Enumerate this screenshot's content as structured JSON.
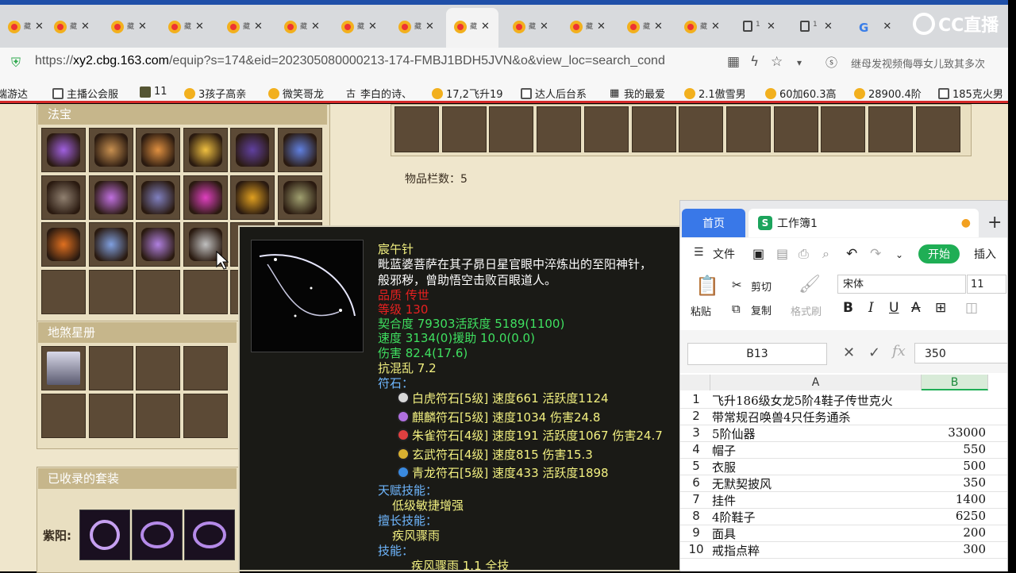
{
  "browser": {
    "tabs": [
      {
        "label": "藏",
        "type": "cbg"
      },
      {
        "label": "藏",
        "type": "cbg"
      },
      {
        "label": "藏",
        "type": "cbg"
      },
      {
        "label": "藏",
        "type": "cbg"
      },
      {
        "label": "藏",
        "type": "cbg"
      },
      {
        "label": "藏",
        "type": "cbg"
      },
      {
        "label": "藏",
        "type": "cbg"
      },
      {
        "label": "藏",
        "type": "cbg"
      },
      {
        "label": "藏",
        "type": "cbg",
        "active": true
      },
      {
        "label": "藏",
        "type": "cbg"
      },
      {
        "label": "藏",
        "type": "cbg"
      },
      {
        "label": "藏",
        "type": "cbg"
      },
      {
        "label": "藏",
        "type": "cbg"
      },
      {
        "label": "1",
        "type": "doc"
      },
      {
        "label": "1",
        "type": "doc"
      },
      {
        "label": "",
        "type": "g"
      }
    ],
    "close_glyph": "✕",
    "watermark": "CC直播",
    "url_prefix": "https://",
    "url_host": "xy2.cbg.163.com",
    "url_path": "/equip?s=174&eid=202305080000213-174-FMBJ1BDH5JVN&o&view_loc=search_cond",
    "search_hint": "继母发视频侮辱女儿致其多次",
    "bookmarks": [
      "端游达",
      "主播公会服",
      "11",
      "3孩子高亲",
      "微笑哥龙",
      "李白的诗、",
      "17,2飞升19",
      "达人后台系",
      "我的最爱",
      "2.1傲雪男",
      "60加60.3高",
      "28900.4阶",
      "185克火男"
    ]
  },
  "page": {
    "fabao_title": "法宝",
    "dishaxing_title": "地煞星册",
    "suit_title": "已收录的套装",
    "suit_label": "紫阳:",
    "item_count": "物品栏数：5"
  },
  "tooltip": {
    "name": "宸午针",
    "desc1": "毗蓝婆菩萨在其子昴日星官眼中淬炼出的至阳神针，",
    "desc2": "般邪秽，曾助悟空击败百眼道人。",
    "quality": "品质  传世",
    "level": "等级  130",
    "fit": "契合度     79303活跃度  5189(1100)",
    "speed": "速度     3134(0)援助     10.0(0.0)",
    "damage": "伤害     82.4(17.6)",
    "anti": "抗混乱 7.2",
    "rune_title": "符石：",
    "runes": [
      {
        "text": "白虎符石[5级] 速度661 活跃度1124",
        "color": "#d8d8d8"
      },
      {
        "text": "麒麟符石[5级] 速度1034 伤害24.8",
        "color": "#b070e0"
      },
      {
        "text": "朱雀符石[4级] 速度191 活跃度1067 伤害24.7",
        "color": "#e04040"
      },
      {
        "text": "玄武符石[4级] 速度815 伤害15.3",
        "color": "#d8b030"
      },
      {
        "text": "青龙符石[5级] 速度433 活跃度1898",
        "color": "#3a8ae0"
      }
    ],
    "talent_title": "天赋技能：",
    "talent": "低级敏捷增强",
    "special_title": "擅长技能：",
    "special": "疾风骤雨",
    "skill_title": "技能：",
    "skill_partial": "疾风骤雨 1.1 全技"
  },
  "sheet": {
    "home_tab": "首页",
    "book_tab": "工作簿1",
    "file_menu": "文件",
    "start_btn": "开始",
    "insert_menu": "插入",
    "paste": "粘贴",
    "cut": "剪切",
    "copy": "复制",
    "format_brush": "格式刷",
    "font": "宋体",
    "font_size": "11",
    "name_box": "B13",
    "formula": "350",
    "col_a": "A",
    "col_b": "B",
    "rows": [
      {
        "n": "1",
        "a": "飞升186级女龙5阶4鞋子传世克火",
        "b": ""
      },
      {
        "n": "2",
        "a": "带常规召唤兽4只任务通杀",
        "b": ""
      },
      {
        "n": "3",
        "a": "5阶仙器",
        "b": "33000"
      },
      {
        "n": "4",
        "a": "帽子",
        "b": "550"
      },
      {
        "n": "5",
        "a": "衣服",
        "b": "500"
      },
      {
        "n": "6",
        "a": "无默契披风",
        "b": "350"
      },
      {
        "n": "7",
        "a": "挂件",
        "b": "1400"
      },
      {
        "n": "8",
        "a": "4阶鞋子",
        "b": "6250"
      },
      {
        "n": "9",
        "a": "面具",
        "b": "200"
      },
      {
        "n": "10",
        "a": "戒指点粹",
        "b": "300"
      }
    ]
  },
  "colors": {
    "quality": "#e82020",
    "stat": "#3fe060",
    "name": "#f2f080",
    "wps_start": "#1fae55",
    "wps_home": "#3978e8"
  }
}
